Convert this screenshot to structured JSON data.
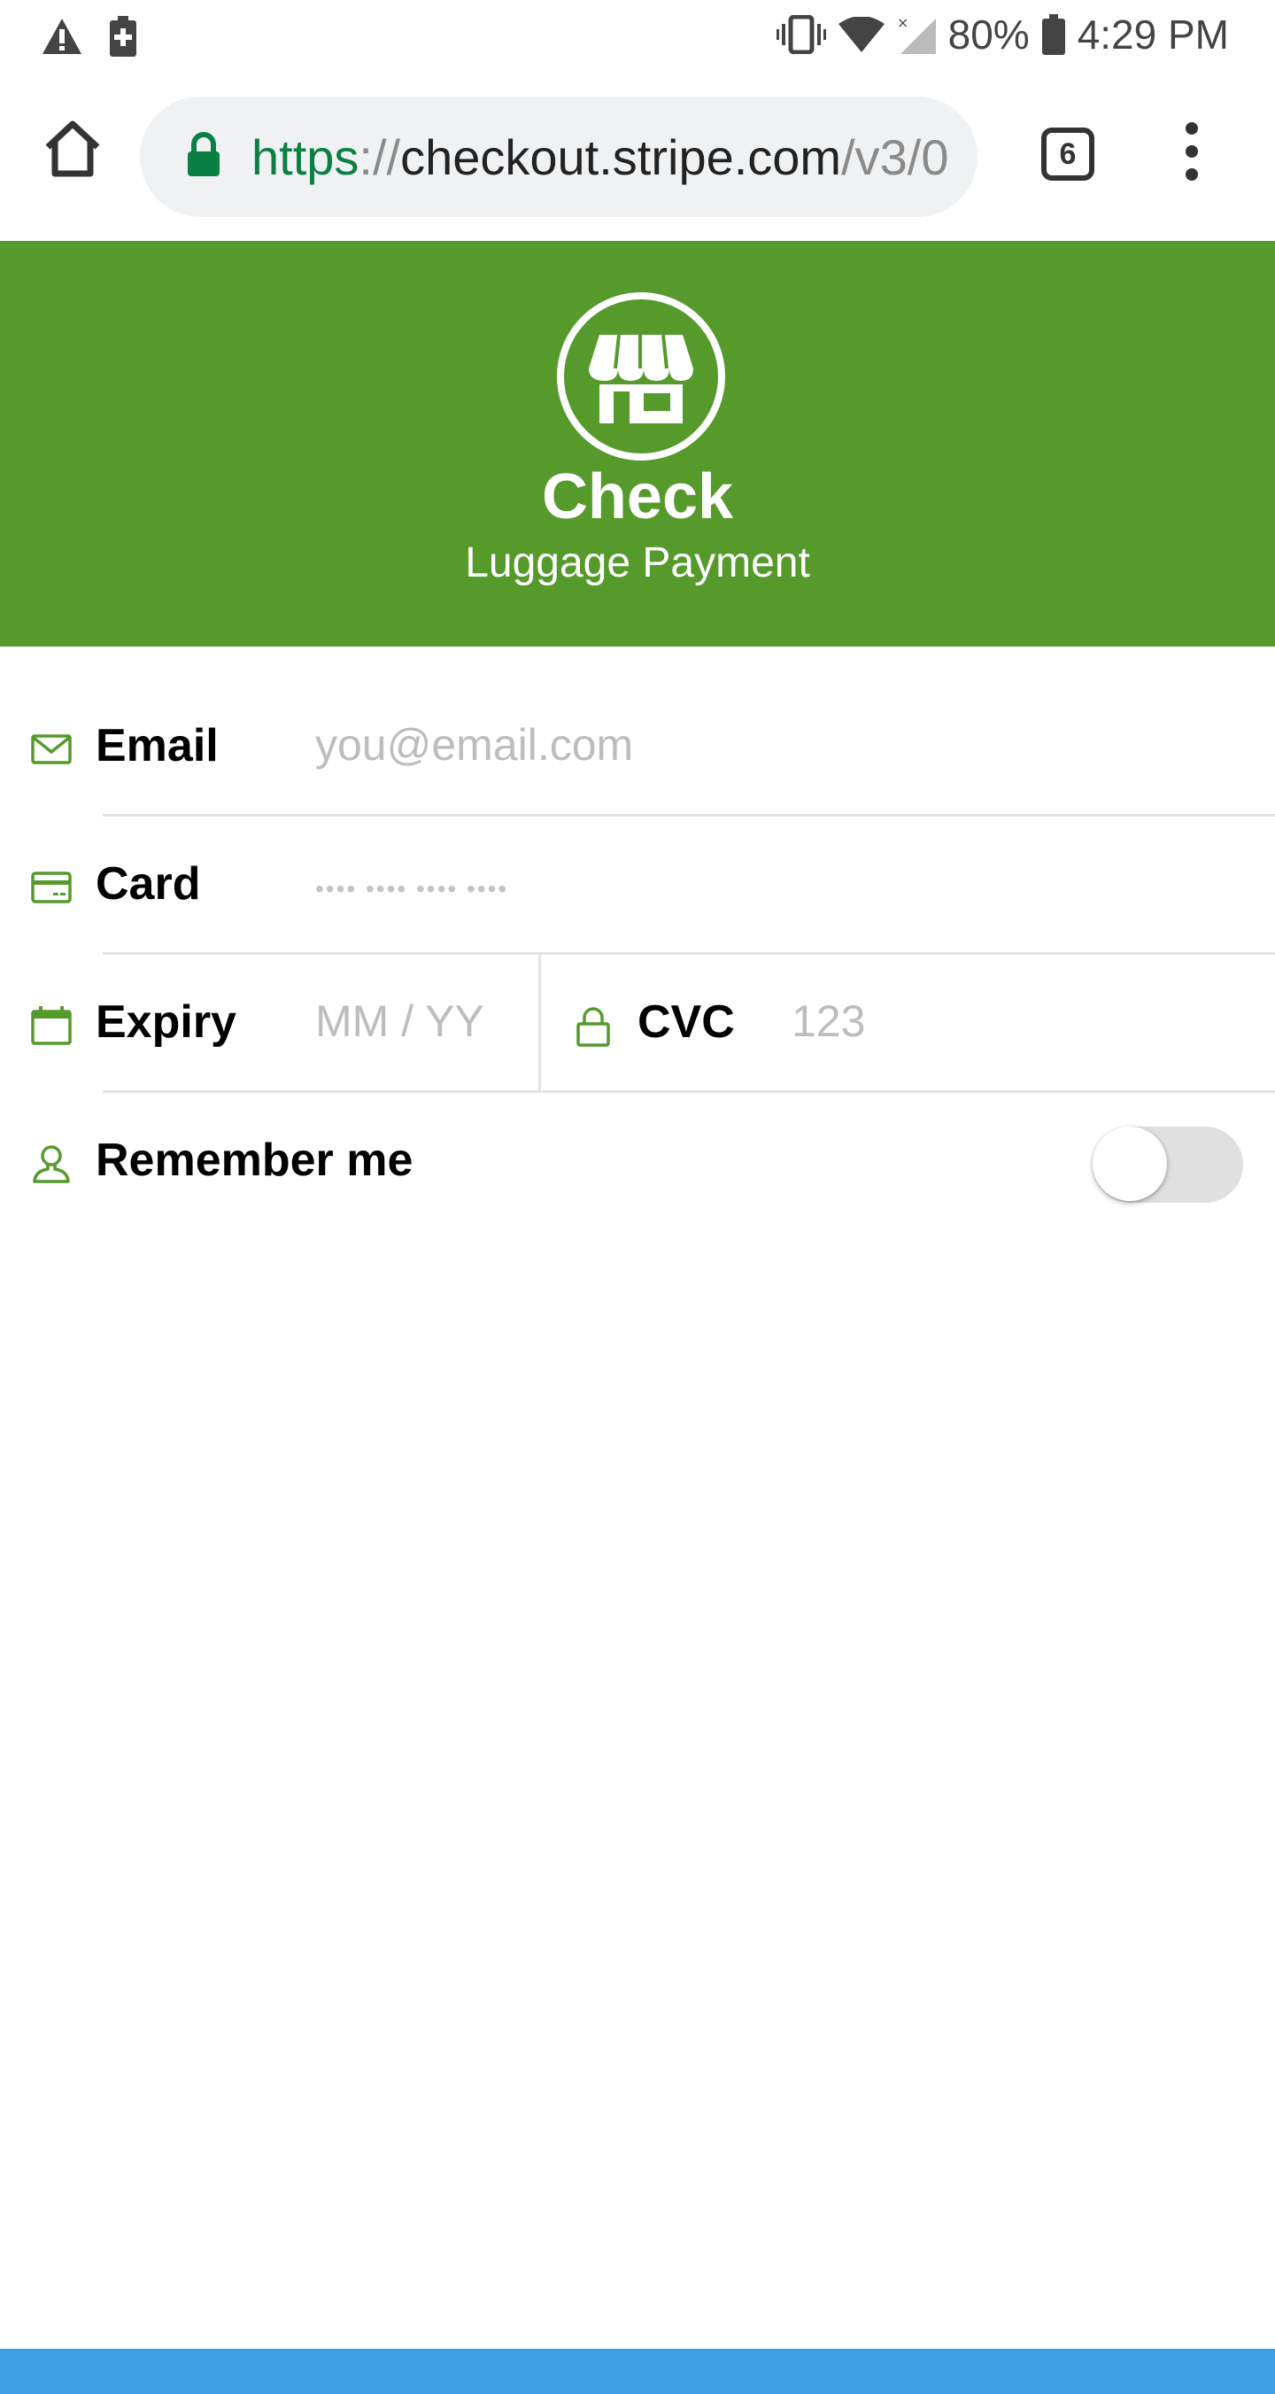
{
  "status_bar": {
    "battery_percent": "80%",
    "time": "4:29 PM"
  },
  "browser": {
    "url_scheme": "https",
    "url_separator": "://",
    "url_host": "checkout.stripe.com",
    "url_path": "/v3/0",
    "tab_count": "6"
  },
  "header": {
    "title": "Check",
    "subtitle": "Luggage Payment",
    "background_color": "#559a2b"
  },
  "form": {
    "email": {
      "label": "Email",
      "placeholder": "you@email.com"
    },
    "card": {
      "label": "Card",
      "placeholder": "•••• •••• •••• ••••"
    },
    "expiry": {
      "label": "Expiry",
      "placeholder": "MM / YY"
    },
    "cvc": {
      "label": "CVC",
      "placeholder": "123"
    },
    "remember": {
      "label": "Remember me",
      "enabled": false
    }
  },
  "icons": {
    "email": "envelope-icon",
    "card": "credit-card-icon",
    "expiry": "calendar-icon",
    "cvc": "lock-icon",
    "remember": "user-icon",
    "accent_color": "#559a2b"
  }
}
